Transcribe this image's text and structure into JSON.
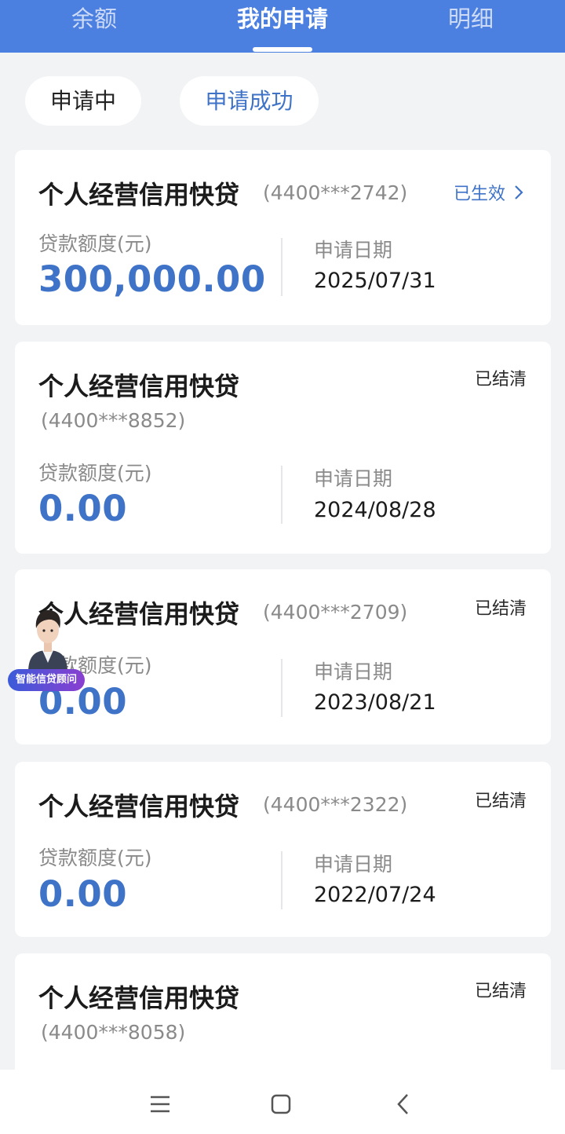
{
  "tabs": [
    {
      "label": "余额",
      "active": false
    },
    {
      "label": "我的申请",
      "active": true
    },
    {
      "label": "明细",
      "active": false
    }
  ],
  "filters": [
    {
      "label": "申请中",
      "selected": false
    },
    {
      "label": "申请成功",
      "selected": true
    }
  ],
  "labels": {
    "amount": "贷款额度(元)",
    "date": "申请日期"
  },
  "applications": [
    {
      "product": "个人经营信用快贷",
      "account": "(4400***2742)",
      "status": "已生效",
      "amount": "300,000.00",
      "date": "2025/07/31"
    },
    {
      "product": "个人经营信用快贷",
      "account": "(4400***8852)",
      "status": "已结清",
      "amount": "0.00",
      "date": "2024/08/28"
    },
    {
      "product": "个人经营信用快贷",
      "account": "(4400***2709)",
      "status": "已结清",
      "amount": "0.00",
      "date": "2023/08/21"
    },
    {
      "product": "个人经营信用快贷",
      "account": "(4400***2322)",
      "status": "已结清",
      "amount": "0.00",
      "date": "2022/07/24"
    },
    {
      "product": "个人经营信用快贷",
      "account": "(4400***8058)",
      "status": "已结清"
    }
  ],
  "advisor": {
    "badge": "智能信贷顾问",
    "icon": "advisor-avatar-icon"
  },
  "nav": {
    "icons": [
      "menu-icon",
      "home-icon",
      "back-icon"
    ]
  },
  "colors": {
    "primary": "#4b7fe0",
    "accent_text": "#3f73c8",
    "background": "#f2f3f5"
  }
}
